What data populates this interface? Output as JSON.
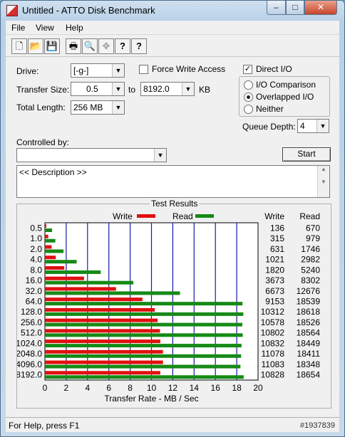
{
  "window": {
    "title": "Untitled - ATTO Disk Benchmark"
  },
  "titlebar_buttons": {
    "minimize": "–",
    "maximize": "□",
    "close": "✕"
  },
  "menu": [
    "File",
    "View",
    "Help"
  ],
  "toolbar": [
    "new-icon",
    "open-icon",
    "save-icon",
    "print-icon",
    "print-preview-icon",
    "move-icon",
    "help-icon",
    "context-help-icon"
  ],
  "toolbar_glyphs": [
    "🗋",
    "📂",
    "💾",
    "🖶",
    "🔍",
    "✥",
    "?",
    "?"
  ],
  "settings": {
    "drive_label": "Drive:",
    "drive_value": "[-g-]",
    "force_write_access": "Force Write Access",
    "direct_io": "Direct I/O",
    "direct_io_checked": true,
    "transfer_size_label": "Transfer Size:",
    "transfer_from": "0.5",
    "to_label": "to",
    "transfer_to": "8192.0",
    "kb_label": "KB",
    "total_length_label": "Total Length:",
    "total_length_value": "256 MB",
    "io_comparison": "I/O Comparison",
    "overlapped_io": "Overlapped I/O",
    "neither": "Neither",
    "selected_io_mode": "Overlapped I/O",
    "queue_depth_label": "Queue Depth:",
    "queue_depth_value": "4",
    "controlled_by_label": "Controlled by:",
    "controlled_by_value": "",
    "start_button": "Start",
    "description": "<< Description >>"
  },
  "results": {
    "title": "Test Results",
    "write_label": "Write",
    "read_label": "Read",
    "write_header": "Write",
    "read_header": "Read",
    "write_color": "#e01010",
    "read_color": "#168a16"
  },
  "chart_data": {
    "type": "bar",
    "orientation": "horizontal",
    "categories": [
      "0.5",
      "1.0",
      "2.0",
      "4.0",
      "8.0",
      "16.0",
      "32.0",
      "64.0",
      "128.0",
      "256.0",
      "512.0",
      "1024.0",
      "2048.0",
      "4096.0",
      "8192.0"
    ],
    "series": [
      {
        "name": "Write",
        "values": [
          136,
          315,
          631,
          1021,
          1820,
          3673,
          6673,
          9153,
          10312,
          10578,
          10802,
          10832,
          11078,
          11083,
          10828
        ]
      },
      {
        "name": "Read",
        "values": [
          670,
          979,
          1746,
          2982,
          5240,
          8302,
          12676,
          18539,
          18618,
          18526,
          18564,
          18449,
          18411,
          18348,
          18654
        ]
      }
    ],
    "xlabel": "Transfer Rate - MB / Sec",
    "xlim": [
      0,
      20
    ],
    "xticks": [
      "0",
      "2",
      "4",
      "6",
      "8",
      "10",
      "12",
      "14",
      "16",
      "18",
      "20"
    ],
    "grid": true,
    "legend_position": "top"
  },
  "status": {
    "text": "For Help, press F1"
  },
  "watermark": "#1937839"
}
